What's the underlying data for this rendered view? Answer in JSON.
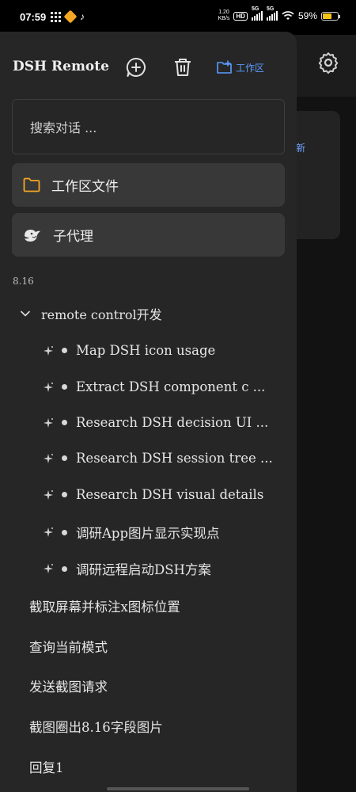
{
  "status_bar": {
    "time": "07:59",
    "net_speed_value": "1.20",
    "net_speed_unit": "KB/s",
    "hd_label": "HD",
    "sim1_label": "5G",
    "sim2_label": "5G",
    "battery_percent": "59%",
    "battery_level": 0.59
  },
  "drawer": {
    "app_title": "DSH Remote",
    "workspace_button_label": "工作区",
    "search_placeholder": "搜索对话 ...",
    "nav": [
      {
        "label": "工作区文件",
        "icon": "folder-icon"
      },
      {
        "label": "子代理",
        "icon": "agent-bird-icon"
      }
    ],
    "date_label": "8.16",
    "group": {
      "label": "remote control开发",
      "children": [
        "Map DSH icon usage",
        "Extract DSH component c ...",
        "Research DSH decision UI  ...",
        "Research DSH session tree  ...",
        "Research DSH visual details",
        "调研App图片显示实现点",
        "调研远程启动DSH方案"
      ]
    },
    "items": [
      "截取屏幕并标注x图标位置",
      "查询当前模式",
      "发送截图请求",
      "截图圈出8.16字段图片",
      "回复1"
    ]
  },
  "background": {
    "card_text": "新"
  },
  "colors": {
    "accent": "#5b9bff",
    "folder": "#f5a623",
    "drawer_bg": "#262626",
    "card_bg": "#383838"
  }
}
